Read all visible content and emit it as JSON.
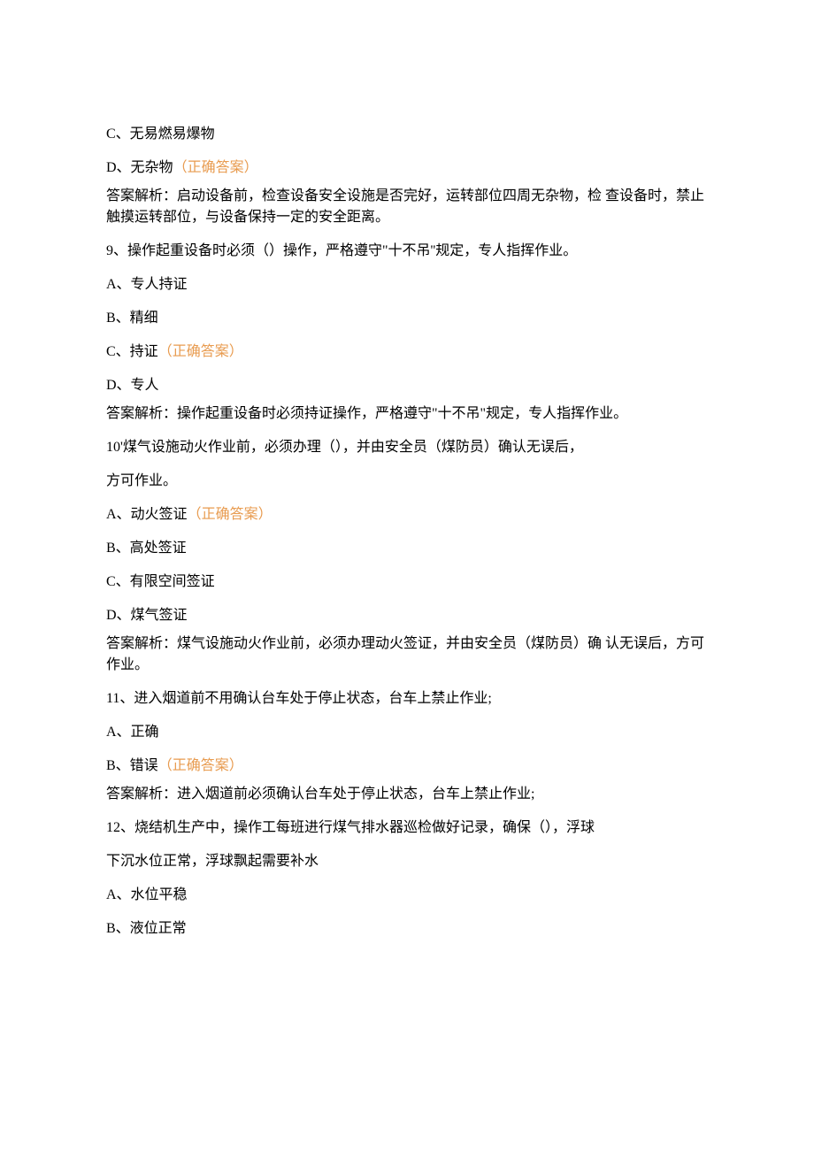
{
  "q8": {
    "optC": "C、无易燃易爆物",
    "optD_prefix": "D、无杂物",
    "optD_correct": "（正确答案）",
    "explanation": "答案解析：启动设备前，检查设备安全设施是否完好，运转部位四周无杂物，检 查设备时，禁止触摸运转部位，与设备保持一定的安全距离。"
  },
  "q9": {
    "question": "9、操作起重设备时必须（）操作，严格遵守\"十不吊''规定，专人指挥作业。",
    "optA": "A、专人持证",
    "optB": "B、精细",
    "optC_prefix": "C、持证",
    "optC_correct": "（正确答案）",
    "optD": "D、专人",
    "explanation": "答案解析：操作起重设备时必须持证操作，严格遵守\"十不吊\"规定，专人指挥作业。"
  },
  "q10": {
    "question_line1": "10'煤气设施动火作业前，必须办理（），并由安全员（煤防员）确认无误后，",
    "question_line2": "方可作业。",
    "optA_prefix": "A、动火签证",
    "optA_correct": "（正确答案）",
    "optB": "B、高处签证",
    "optC": "C、有限空间签证",
    "optD": "D、煤气签证",
    "explanation": "答案解析：煤气设施动火作业前，必须办理动火签证，并由安全员（煤防员）确 认无误后，方可作业。"
  },
  "q11": {
    "question": "11、进入烟道前不用确认台车处于停止状态，台车上禁止作业;",
    "optA": "A、正确",
    "optB_prefix": "B、错误",
    "optB_correct": "（正确答案）",
    "explanation": "答案解析：进入烟道前必须确认台车处于停止状态，台车上禁止作业;"
  },
  "q12": {
    "question_line1": "12、烧结机生产中，操作工每班进行煤气排水器巡检做好记录，确保（），浮球",
    "question_line2": "下沉水位正常，浮球飘起需要补水",
    "optA": "A、水位平稳",
    "optB": "B、液位正常"
  }
}
